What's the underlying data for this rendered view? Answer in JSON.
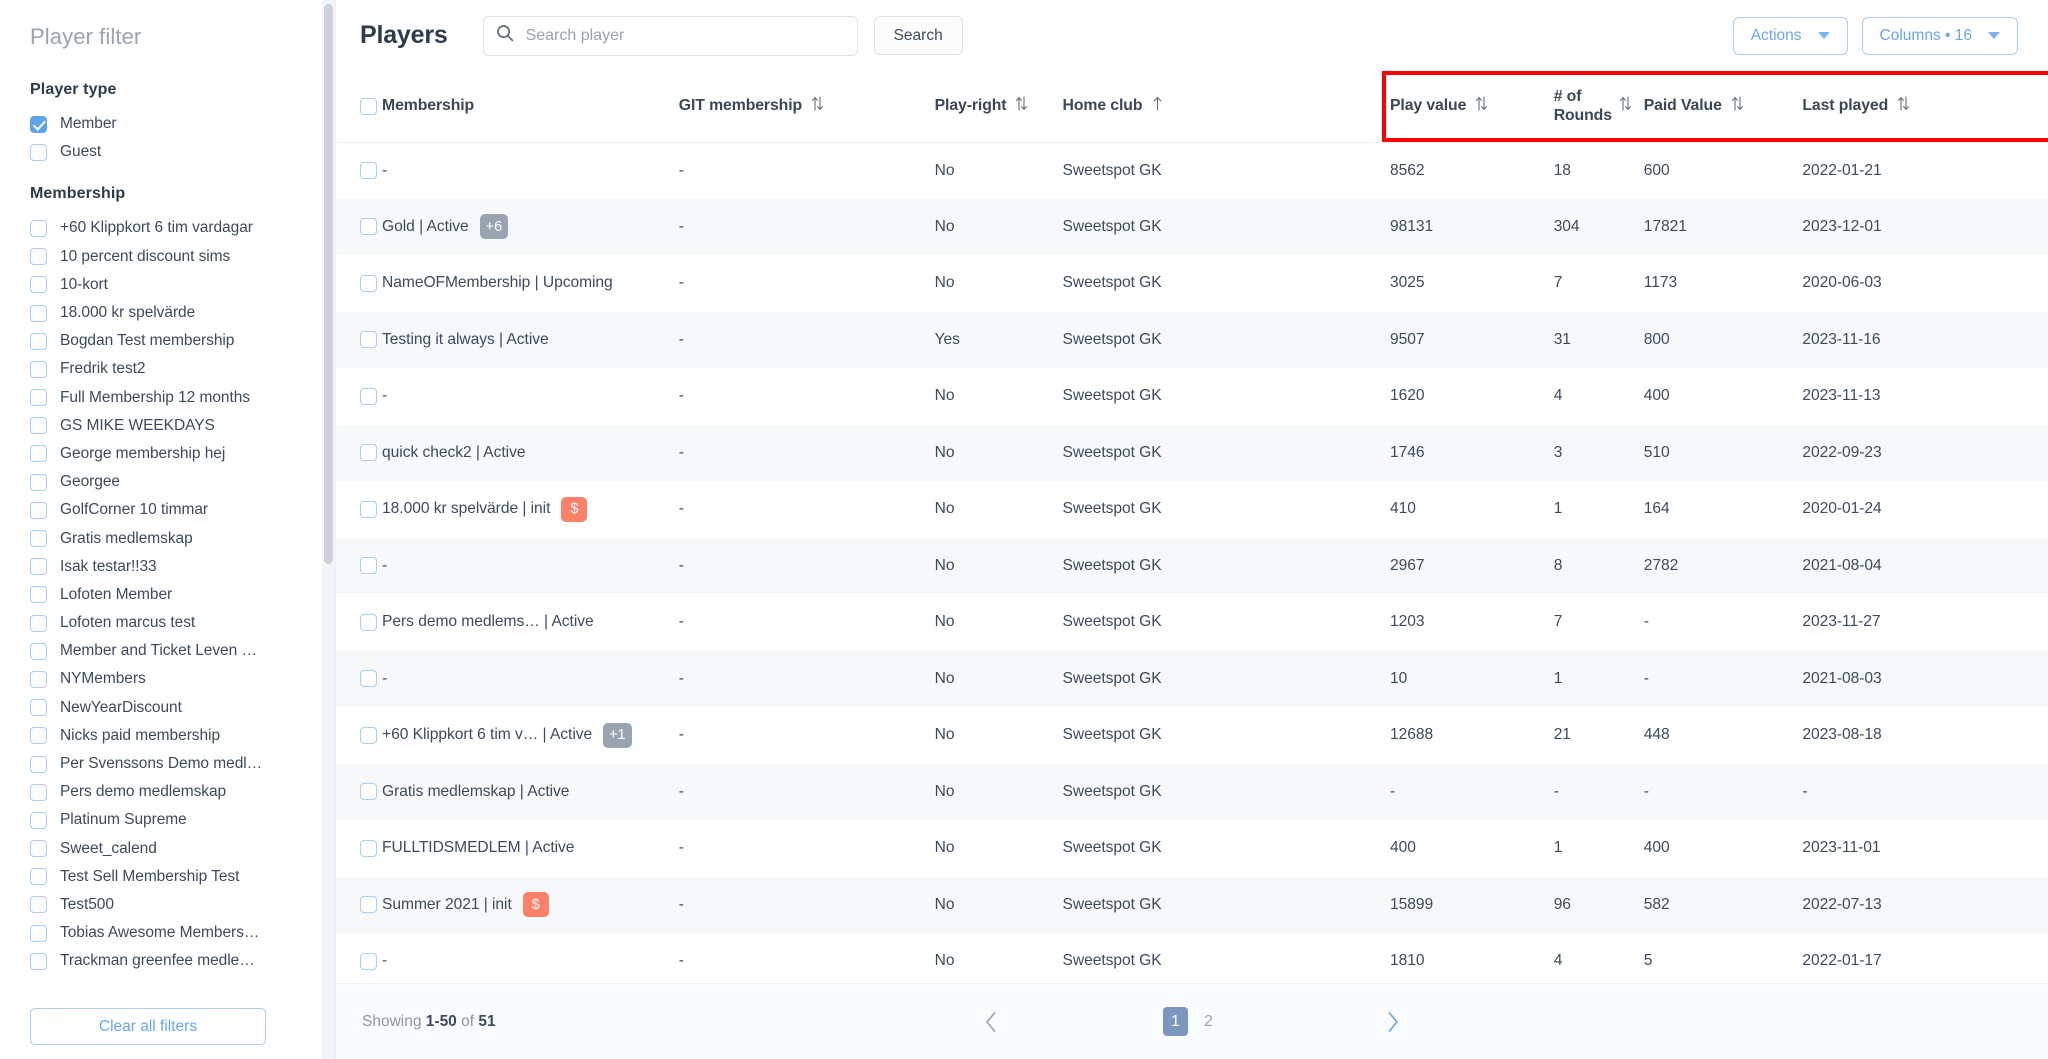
{
  "sidebar": {
    "title": "Player filter",
    "groups": [
      {
        "title": "Player type",
        "options": [
          {
            "label": "Member",
            "checked": true
          },
          {
            "label": "Guest",
            "checked": false
          }
        ]
      },
      {
        "title": "Membership",
        "options": [
          {
            "label": "+60 Klippkort 6 tim vardagar",
            "checked": false
          },
          {
            "label": "10 percent discount sims",
            "checked": false
          },
          {
            "label": "10-kort",
            "checked": false
          },
          {
            "label": "18.000 kr spelvärde",
            "checked": false
          },
          {
            "label": "Bogdan Test membership",
            "checked": false
          },
          {
            "label": "Fredrik test2",
            "checked": false
          },
          {
            "label": "Full Membership 12 months",
            "checked": false
          },
          {
            "label": "GS MIKE WEEKDAYS",
            "checked": false
          },
          {
            "label": "George membership hej",
            "checked": false
          },
          {
            "label": "Georgee",
            "checked": false
          },
          {
            "label": "GolfCorner 10 timmar",
            "checked": false
          },
          {
            "label": "Gratis medlemskap",
            "checked": false
          },
          {
            "label": "Isak testar!!33",
            "checked": false
          },
          {
            "label": "Lofoten Member",
            "checked": false
          },
          {
            "label": "Lofoten marcus test",
            "checked": false
          },
          {
            "label": "Member and Ticket Leven …",
            "checked": false
          },
          {
            "label": "NYMembers",
            "checked": false
          },
          {
            "label": "NewYearDiscount",
            "checked": false
          },
          {
            "label": "Nicks paid membership",
            "checked": false
          },
          {
            "label": "Per Svenssons Demo medl…",
            "checked": false
          },
          {
            "label": "Pers demo medlemskap",
            "checked": false
          },
          {
            "label": "Platinum Supreme",
            "checked": false
          },
          {
            "label": "Sweet_calend",
            "checked": false
          },
          {
            "label": "Test Sell Membership Test",
            "checked": false
          },
          {
            "label": "Test500",
            "checked": false
          },
          {
            "label": "Tobias Awesome Members…",
            "checked": false
          },
          {
            "label": "Trackman greenfee medle…",
            "checked": false
          }
        ]
      }
    ],
    "clear_button": "Clear all filters"
  },
  "topbar": {
    "title": "Players",
    "search_placeholder": "Search player",
    "search_value": "",
    "search_button": "Search",
    "actions_button": "Actions",
    "columns_button": "Columns • 16"
  },
  "table": {
    "columns": [
      {
        "key": "membership",
        "label": "Membership",
        "sortable": false
      },
      {
        "key": "git",
        "label": "GIT membership",
        "sortable": true
      },
      {
        "key": "playright",
        "label": "Play-right",
        "sortable": true
      },
      {
        "key": "homeclub",
        "label": "Home club",
        "sortable": true,
        "sort_icon": "arrow-up"
      },
      {
        "key": "playvalue",
        "label": "Play value",
        "sortable": true
      },
      {
        "key": "rounds",
        "label": "# of Rounds",
        "sortable": true
      },
      {
        "key": "paidvalue",
        "label": "Paid Value",
        "sortable": true
      },
      {
        "key": "lastplayed",
        "label": "Last played",
        "sortable": true
      }
    ],
    "highlight_color": "#ff0000",
    "rows": [
      {
        "membership": "-",
        "badge": null,
        "git": "-",
        "playright": "No",
        "homeclub": "Sweetspot GK",
        "playvalue": "8562",
        "rounds": "18",
        "paidvalue": "600",
        "lastplayed": "2022-01-21"
      },
      {
        "membership": "Gold | Active",
        "badge": {
          "text": "+6",
          "color": "gray"
        },
        "git": "-",
        "playright": "No",
        "homeclub": "Sweetspot GK",
        "playvalue": "98131",
        "rounds": "304",
        "paidvalue": "17821",
        "lastplayed": "2023-12-01"
      },
      {
        "membership": "NameOFMembership | Upcoming",
        "badge": null,
        "git": "-",
        "playright": "No",
        "homeclub": "Sweetspot GK",
        "playvalue": "3025",
        "rounds": "7",
        "paidvalue": "1173",
        "lastplayed": "2020-06-03"
      },
      {
        "membership": "Testing it always | Active",
        "badge": null,
        "git": "-",
        "playright": "Yes",
        "homeclub": "Sweetspot GK",
        "playvalue": "9507",
        "rounds": "31",
        "paidvalue": "800",
        "lastplayed": "2023-11-16"
      },
      {
        "membership": "-",
        "badge": null,
        "git": "-",
        "playright": "No",
        "homeclub": "Sweetspot GK",
        "playvalue": "1620",
        "rounds": "4",
        "paidvalue": "400",
        "lastplayed": "2023-11-13"
      },
      {
        "membership": "quick check2 | Active",
        "badge": null,
        "git": "-",
        "playright": "No",
        "homeclub": "Sweetspot GK",
        "playvalue": "1746",
        "rounds": "3",
        "paidvalue": "510",
        "lastplayed": "2022-09-23"
      },
      {
        "membership": "18.000 kr spelvärde | init",
        "badge": {
          "text": "$",
          "color": "orange"
        },
        "git": "-",
        "playright": "No",
        "homeclub": "Sweetspot GK",
        "playvalue": "410",
        "rounds": "1",
        "paidvalue": "164",
        "lastplayed": "2020-01-24"
      },
      {
        "membership": "-",
        "badge": null,
        "git": "-",
        "playright": "No",
        "homeclub": "Sweetspot GK",
        "playvalue": "2967",
        "rounds": "8",
        "paidvalue": "2782",
        "lastplayed": "2021-08-04"
      },
      {
        "membership": "Pers demo medlems… | Active",
        "badge": null,
        "git": "-",
        "playright": "No",
        "homeclub": "Sweetspot GK",
        "playvalue": "1203",
        "rounds": "7",
        "paidvalue": "-",
        "lastplayed": "2023-11-27"
      },
      {
        "membership": "-",
        "badge": null,
        "git": "-",
        "playright": "No",
        "homeclub": "Sweetspot GK",
        "playvalue": "10",
        "rounds": "1",
        "paidvalue": "-",
        "lastplayed": "2021-08-03"
      },
      {
        "membership": "+60 Klippkort 6 tim v… | Active",
        "badge": {
          "text": "+1",
          "color": "gray"
        },
        "git": "-",
        "playright": "No",
        "homeclub": "Sweetspot GK",
        "playvalue": "12688",
        "rounds": "21",
        "paidvalue": "448",
        "lastplayed": "2023-08-18"
      },
      {
        "membership": "Gratis medlemskap | Active",
        "badge": null,
        "git": "-",
        "playright": "No",
        "homeclub": "Sweetspot GK",
        "playvalue": "-",
        "rounds": "-",
        "paidvalue": "-",
        "lastplayed": "-"
      },
      {
        "membership": "FULLTIDSMEDLEM | Active",
        "badge": null,
        "git": "-",
        "playright": "No",
        "homeclub": "Sweetspot GK",
        "playvalue": "400",
        "rounds": "1",
        "paidvalue": "400",
        "lastplayed": "2023-11-01"
      },
      {
        "membership": "Summer 2021 | init",
        "badge": {
          "text": "$",
          "color": "orange"
        },
        "git": "-",
        "playright": "No",
        "homeclub": "Sweetspot GK",
        "playvalue": "15899",
        "rounds": "96",
        "paidvalue": "582",
        "lastplayed": "2022-07-13"
      },
      {
        "membership": "-",
        "badge": null,
        "git": "-",
        "playright": "No",
        "homeclub": "Sweetspot GK",
        "playvalue": "1810",
        "rounds": "4",
        "paidvalue": "5",
        "lastplayed": "2022-01-17"
      }
    ]
  },
  "footer": {
    "showing_prefix": "Showing",
    "showing_range": "1-50",
    "showing_middle": "of",
    "showing_total": "51",
    "pages": [
      {
        "label": "1",
        "active": true
      },
      {
        "label": "2",
        "active": false
      }
    ]
  }
}
